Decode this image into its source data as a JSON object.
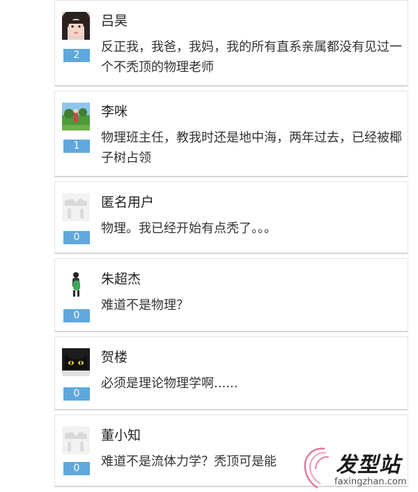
{
  "comments": [
    {
      "user": "吕昊",
      "likes": "2",
      "text": "反正我，我爸，我妈，我的所有直系亲属都没有见过一个不秃顶的物理老师",
      "avatar_icon": "girl-photo-avatar"
    },
    {
      "user": "李咪",
      "likes": "1",
      "text": "物理班主任，教我时还是地中海，两年过去，已经被椰子树占领",
      "avatar_icon": "anime-landscape-avatar"
    },
    {
      "user": "匿名用户",
      "likes": "0",
      "text": "物理。我已经开始有点秃了。。。",
      "avatar_icon": "default-avatar"
    },
    {
      "user": "朱超杰",
      "likes": "0",
      "text": "难道不是物理？",
      "avatar_icon": "backpack-person-avatar"
    },
    {
      "user": "贺楼",
      "likes": "0",
      "text": "必须是理论物理学啊......",
      "avatar_icon": "black-cat-avatar"
    },
    {
      "user": "董小知",
      "likes": "0",
      "text": "难道不是流体力学？秃顶可是能",
      "avatar_icon": "default-avatar"
    }
  ],
  "watermark": {
    "logo": "发型站",
    "domain": "faxingzhan.com"
  },
  "colors": {
    "likes_badge": "#5fa8de",
    "card_border": "#e3e3e3"
  }
}
